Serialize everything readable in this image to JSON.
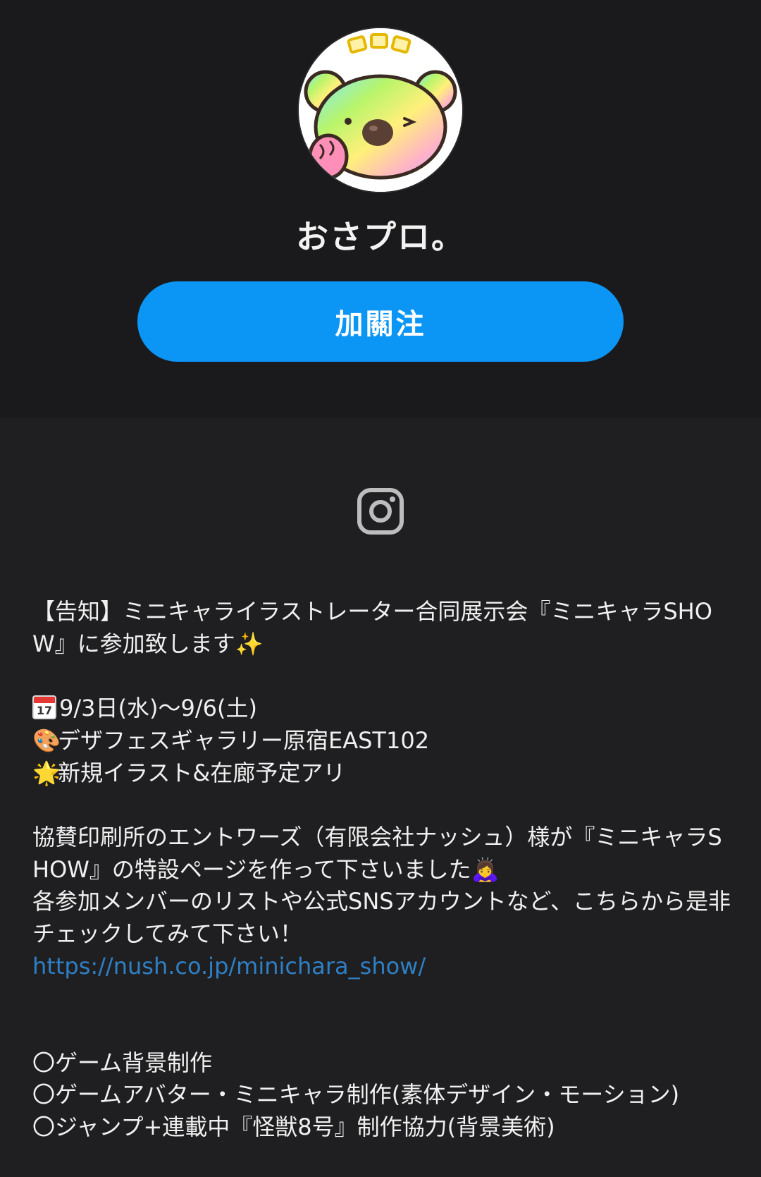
{
  "profile": {
    "name": "おさプロ。",
    "follow_label": "加關注",
    "avatar_icon": "koala-avatar-icon"
  },
  "social": {
    "instagram_icon": "instagram-icon"
  },
  "bio": {
    "announcement": "【告知】ミニキャライラストレーター合同展示会『ミニキャラSHOW』に参加致します✨",
    "date_emoji": "📅",
    "date_cal_day": "17",
    "date_text": "9/3日(水)〜9/6(土)",
    "venue_emoji": "🎨",
    "venue_text": "デザフェスギャラリー原宿EAST102",
    "new_emoji": "🌟",
    "new_text": "新規イラスト&在廊予定アリ",
    "sponsor_text": "協賛印刷所のエントワーズ（有限会社ナッシュ）様が『ミニキャラSHOW』の特設ページを作って下さいました🙇‍♀️",
    "members_text": "各参加メンバーのリストや公式SNSアカウントなど、こちらから是非チェックしてみて下さい！",
    "url": "https://nush.co.jp/minichara_show/",
    "work_1": "〇ゲーム背景制作",
    "work_2": "〇ゲームアバター・ミニキャラ制作(素体デザイン・モーション)",
    "work_3": "〇ジャンプ+連載中『怪獣8号』制作協力(背景美術)"
  },
  "colors": {
    "background": "#1f1f21",
    "header_background": "#1a1a1c",
    "follow_button": "#0b95f5",
    "link": "#2f7fc4",
    "text": "#f0f0f0"
  }
}
